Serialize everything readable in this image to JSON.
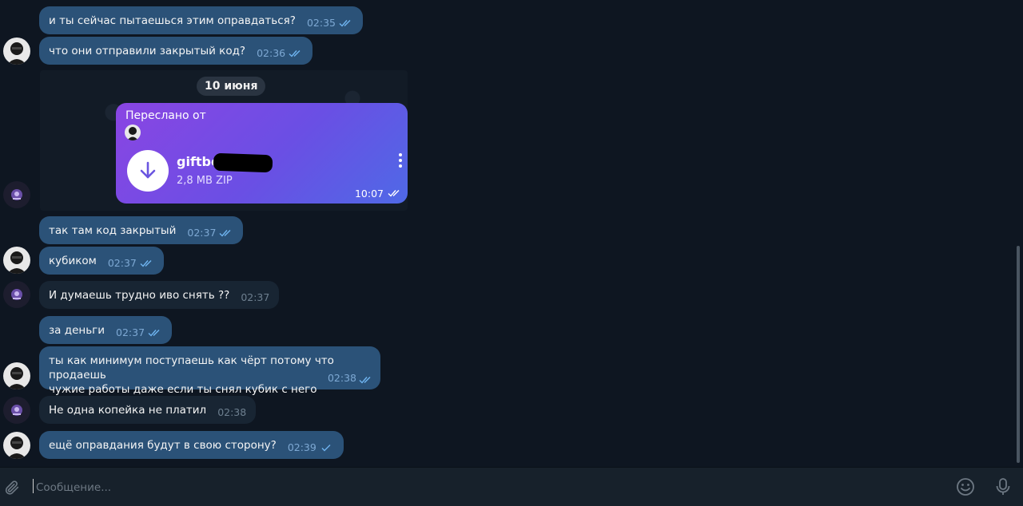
{
  "messages": [
    {
      "text": "и ты сейчас пытаешься этим оправдаться?",
      "time": "02:35"
    },
    {
      "text": "что они отправили закрытый код?",
      "time": "02:36"
    },
    {
      "text": "так там код закрытый",
      "time": "02:37"
    },
    {
      "text": "кубиком",
      "time": "02:37"
    },
    {
      "text": "И думаешь трудно иво снять ??",
      "time": "02:37"
    },
    {
      "text": "за деньги",
      "time": "02:37"
    },
    {
      "line1": "ты как минимум поступаешь как чёрт потому что продаешь",
      "line2": "чужие работы даже если ты снял кубик с него",
      "time": "02:38"
    },
    {
      "text": "Не одна копейка не платил",
      "time": "02:38"
    },
    {
      "text": "ещё оправдания будут в свою сторону?",
      "time": "02:39"
    }
  ],
  "date_separator": "10 июня",
  "forwarded": {
    "label": "Переслано от",
    "file_name": "giftbc",
    "file_size": "2,8 MB ZIP",
    "time": "10:07"
  },
  "composer": {
    "placeholder": "Сообщение..."
  },
  "colors": {
    "background": "#0e1621",
    "outgoing_bubble": "#2b5278",
    "incoming_bubble": "#182533",
    "composer": "#17212b",
    "forward_gradient_start": "#8a45e3",
    "forward_gradient_end": "#4f69e6"
  },
  "icons": [
    "double-check-icon",
    "single-check-icon",
    "download-icon",
    "more-vertical-icon",
    "paperclip-icon",
    "emoji-icon",
    "microphone-icon"
  ]
}
